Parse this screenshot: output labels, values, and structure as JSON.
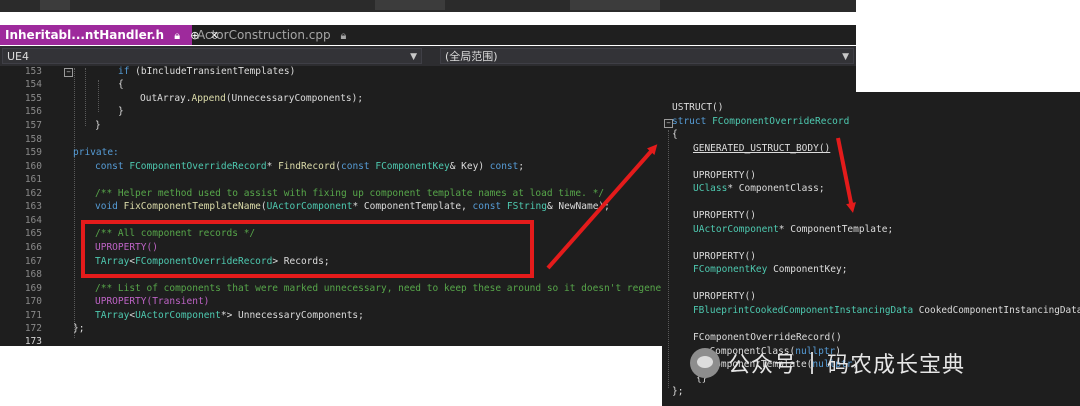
{
  "tabs": [
    {
      "label": "Inheritabl...ntHandler.h",
      "active": true,
      "icons": [
        "lock-icon",
        "pin-icon",
        "close-icon"
      ]
    },
    {
      "label": "ActorConstruction.cpp",
      "active": false,
      "icons": [
        "lock-icon"
      ]
    }
  ],
  "nav": {
    "project": "UE4",
    "scope": "(全局范围)"
  },
  "editor_lines": [
    {
      "n": "153",
      "code": "if (bIncludeTransientTemplates)"
    },
    {
      "n": "154",
      "code": "{"
    },
    {
      "n": "155",
      "code": "OutArray.Append(UnnecessaryComponents);"
    },
    {
      "n": "156",
      "code": "}"
    },
    {
      "n": "157",
      "code": "}"
    },
    {
      "n": "158",
      "code": ""
    },
    {
      "n": "159",
      "code": "private:"
    },
    {
      "n": "160",
      "code": "const FComponentOverrideRecord* FindRecord(const FComponentKey& Key) const;"
    },
    {
      "n": "161",
      "code": ""
    },
    {
      "n": "162",
      "code": "/** Helper method used to assist with fixing up component template names at load time. */"
    },
    {
      "n": "163",
      "code": "void FixComponentTemplateName(UActorComponent* ComponentTemplate, const FString& NewName);"
    },
    {
      "n": "164",
      "code": ""
    },
    {
      "n": "165",
      "code": "/** All component records */"
    },
    {
      "n": "166",
      "code": "UPROPERTY()"
    },
    {
      "n": "167",
      "code": "TArray<FComponentOverrideRecord> Records;"
    },
    {
      "n": "168",
      "code": ""
    },
    {
      "n": "169",
      "code": "/** List of components that were marked unnecessary, need to keep these around so it doesn't regenerate"
    },
    {
      "n": "170",
      "code": "UPROPERTY(Transient)"
    },
    {
      "n": "171",
      "code": "TArray<UActorComponent*> UnnecessaryComponents;"
    },
    {
      "n": "172",
      "code": "};"
    },
    {
      "n": "173",
      "code": ""
    }
  ],
  "struct_panel": {
    "lines": [
      "USTRUCT()",
      "struct FComponentOverrideRecord",
      "{",
      "GENERATED_USTRUCT_BODY()",
      "",
      "UPROPERTY()",
      "UClass* ComponentClass;",
      "",
      "UPROPERTY()",
      "UActorComponent* ComponentTemplate;",
      "",
      "UPROPERTY()",
      "FComponentKey ComponentKey;",
      "",
      "UPROPERTY()",
      "FBlueprintCookedComponentInstancingData CookedComponentInstancingData;",
      "",
      "FComponentOverrideRecord()",
      ": ComponentClass(nullptr)",
      ", ComponentTemplate(nullptr)",
      "{}",
      "};"
    ]
  },
  "watermark": {
    "account": "公众号",
    "name": "码农成长宝典"
  },
  "colors": {
    "tab_active": "#9e2a9c",
    "editor_bg": "#1e1e1e",
    "highlight_box": "#e41b1b",
    "keyword": "#569cd6",
    "type": "#4ec9b0",
    "comment": "#57a64a",
    "macro": "#bd63c5"
  }
}
